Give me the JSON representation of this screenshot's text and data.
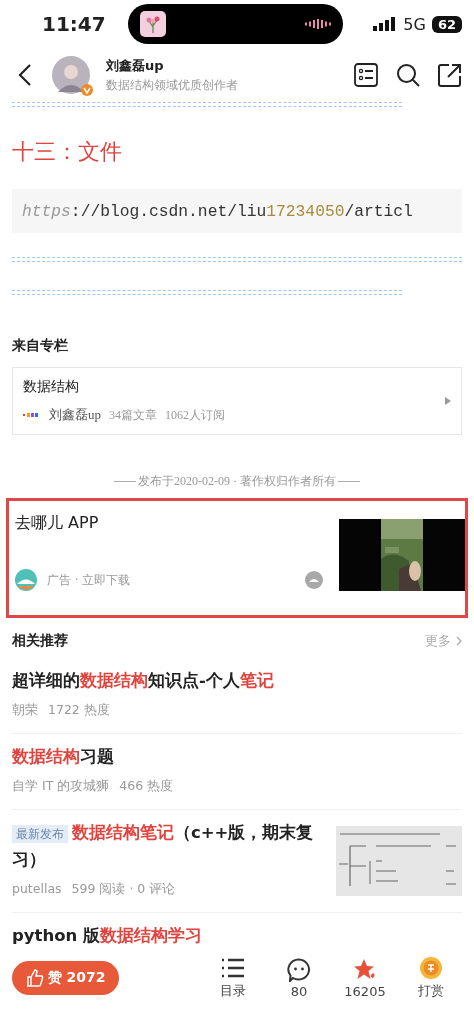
{
  "status_bar": {
    "time": "11:47",
    "network": "5G",
    "battery": "62"
  },
  "header": {
    "author": "刘鑫磊up",
    "subtitle": "数据结构领域优质创作者",
    "verified": true
  },
  "article": {
    "heading": "十三：文件",
    "code": [
      {
        "text": "https",
        "kind": "keyword"
      },
      {
        "text": "://blog.csdn.net/liu",
        "kind": "plain"
      },
      {
        "text": "17234050",
        "kind": "number"
      },
      {
        "text": "/articl",
        "kind": "plain"
      }
    ]
  },
  "column": {
    "section_title": "来自专栏",
    "name": "数据结构",
    "author": "刘鑫磊up",
    "articles": "34篇文章",
    "subscribers": "1062人订阅"
  },
  "publish_note": "发布于2020-02-09 · 著作权归作者所有",
  "ad": {
    "title": "去哪儿 APP",
    "meta": "广告 · 立即下载",
    "highlighted": true
  },
  "related": {
    "title": "相关推荐",
    "more": "更多",
    "items": [
      {
        "title": [
          {
            "text": "超详细的",
            "highlight": false
          },
          {
            "text": "数据结构",
            "highlight": true
          },
          {
            "text": "知识点-个人",
            "highlight": false
          },
          {
            "text": "笔记",
            "highlight": true
          }
        ],
        "author": "朝荣",
        "stats": "1722 热度",
        "thumbnail": false
      },
      {
        "title": [
          {
            "text": "数据结构",
            "highlight": true
          },
          {
            "text": "习题",
            "highlight": false
          }
        ],
        "author": "自学 IT 的攻城狮",
        "stats": "466 热度",
        "thumbnail": false
      },
      {
        "tag": "最新发布",
        "title": [
          {
            "text": "数据结构笔记",
            "highlight": true
          },
          {
            "text": "（c++版，期末复习）",
            "highlight": false
          }
        ],
        "author": "putellas",
        "stats": "599 阅读 · 0 评论",
        "thumbnail": true
      },
      {
        "title": [
          {
            "text": "python 版",
            "highlight": false
          },
          {
            "text": "数据结构学习",
            "highlight": true
          }
        ],
        "thumbnail": false
      }
    ]
  },
  "bottom_bar": {
    "like": "赞 2072",
    "actions": [
      {
        "kind": "toc",
        "label": "目录"
      },
      {
        "kind": "comment",
        "label": "80"
      },
      {
        "kind": "favorite",
        "label": "16205"
      },
      {
        "kind": "reward",
        "label": "打赏"
      }
    ]
  }
}
